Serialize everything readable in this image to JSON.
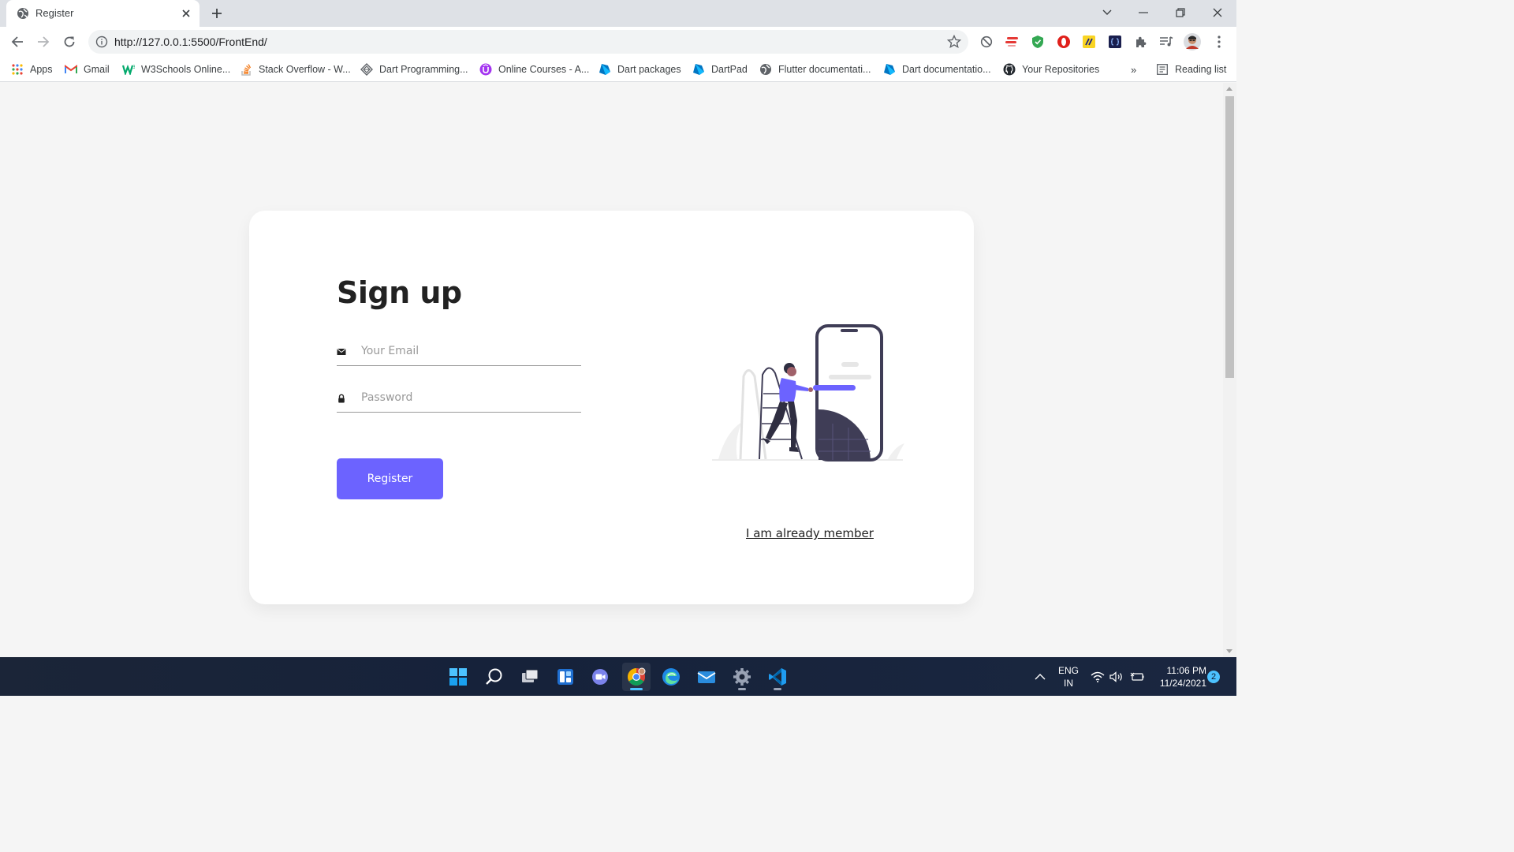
{
  "browser": {
    "tab": {
      "title": "Register"
    },
    "address": {
      "url": "http://127.0.0.1:5500/FrontEnd/"
    },
    "bookmarks": [
      {
        "label": "Apps",
        "icon": "apps-grid-icon"
      },
      {
        "label": "Gmail",
        "icon": "gmail-icon"
      },
      {
        "label": "W3Schools Online...",
        "icon": "w3schools-icon"
      },
      {
        "label": "Stack Overflow - W...",
        "icon": "stackoverflow-icon"
      },
      {
        "label": "Dart Programming...",
        "icon": "dart-icon"
      },
      {
        "label": "Online Courses - A...",
        "icon": "udemy-icon"
      },
      {
        "label": "Dart packages",
        "icon": "dart-packages-icon"
      },
      {
        "label": "DartPad",
        "icon": "dartpad-icon"
      },
      {
        "label": "Flutter documentati...",
        "icon": "globe-icon"
      },
      {
        "label": "Dart documentatio...",
        "icon": "dart-docs-icon"
      },
      {
        "label": "Your Repositories",
        "icon": "github-icon"
      }
    ],
    "overflow_label": "»",
    "reading_list_label": "Reading list"
  },
  "signup": {
    "title": "Sign up",
    "email_placeholder": "Your Email",
    "password_placeholder": "Password",
    "register_label": "Register",
    "member_link": "I am already member"
  },
  "taskbar": {
    "apps": [
      "start-icon",
      "search-icon",
      "task-view-icon",
      "widgets-icon",
      "teams-chat-icon",
      "chrome-icon",
      "edge-icon",
      "mail-icon",
      "settings-icon",
      "vscode-icon"
    ],
    "language": {
      "line1": "ENG",
      "line2": "IN"
    },
    "time": "11:06 PM",
    "date": "11/24/2021",
    "notification_count": "2"
  },
  "colors": {
    "accent": "#6c63ff",
    "page_background": "#f5f5f5",
    "card_background": "#ffffff",
    "illustration_dark": "#3f3d56"
  }
}
